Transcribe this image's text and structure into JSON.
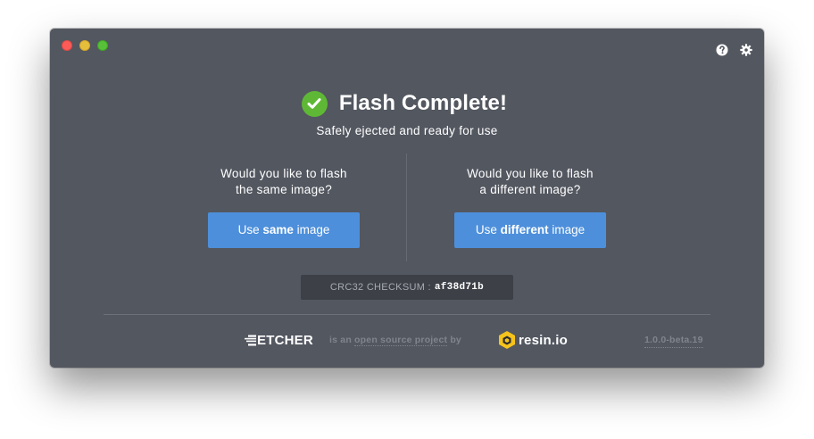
{
  "window": {
    "title": "",
    "colors": {
      "background": "#535760",
      "accent": "#4d8fdb",
      "success": "#5fb835",
      "checksum_bg": "#3d4047",
      "muted_text": "#80858d"
    }
  },
  "titlebar": {
    "help_icon": "help-circle-icon",
    "settings_icon": "gear-icon"
  },
  "status": {
    "icon": "check-circle-icon",
    "title": "Flash Complete!",
    "subtitle": "Safely ejected and ready for use"
  },
  "same_image": {
    "question": "Would you like to flash\nthe same image?",
    "button_prefix": "Use ",
    "button_bold": "same",
    "button_suffix": " image"
  },
  "different_image": {
    "question": "Would you like to flash\na different image?",
    "button_prefix": "Use ",
    "button_bold": "different",
    "button_suffix": " image"
  },
  "checksum": {
    "label": "CRC32 CHECKSUM :",
    "value": "af38d71b"
  },
  "footer": {
    "etcher_logo": "ETCHER",
    "tagline_prefix": "is an ",
    "tagline_link": "open source project",
    "tagline_suffix": " by",
    "resin_logo": "resin.io",
    "version": "1.0.0-beta.19"
  }
}
